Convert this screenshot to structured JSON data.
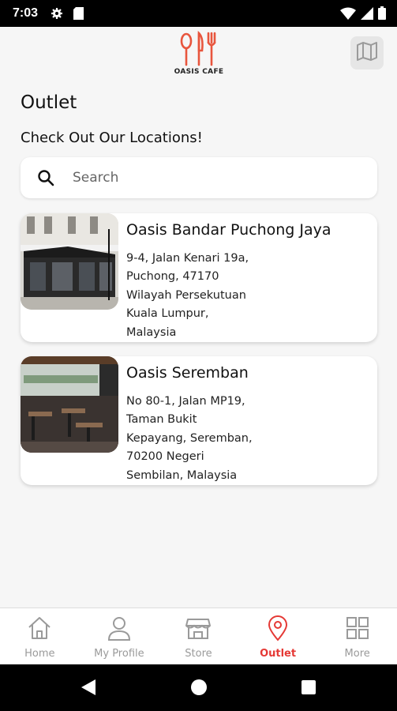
{
  "status_bar": {
    "time": "7:03",
    "left_icons": [
      "gear-icon",
      "sd-card-icon"
    ],
    "right_icons": [
      "wifi-icon",
      "signal-icon",
      "battery-icon"
    ]
  },
  "header": {
    "logo_text": "OASIS CAFE",
    "map_button_icon": "map-icon"
  },
  "page": {
    "title": "Outlet",
    "subtitle": "Check Out Our Locations!"
  },
  "search": {
    "placeholder": "Search",
    "value": ""
  },
  "outlets": [
    {
      "name": "Oasis Bandar Puchong Jaya",
      "address_lines": [
        "9-4, Jalan Kenari 19a,",
        "Puchong, 47170",
        "Wilayah Persekutuan",
        "Kuala Lumpur,",
        "Malaysia"
      ]
    },
    {
      "name": "Oasis Seremban",
      "address_lines": [
        "No 80-1, Jalan MP19,",
        "Taman Bukit",
        "Kepayang, Seremban,",
        "70200 Negeri",
        "Sembilan, Malaysia"
      ]
    }
  ],
  "bottom_nav": {
    "items": [
      {
        "label": "Home",
        "icon": "home-icon"
      },
      {
        "label": "My Profile",
        "icon": "profile-icon"
      },
      {
        "label": "Store",
        "icon": "store-icon"
      },
      {
        "label": "Outlet",
        "icon": "location-pin-icon"
      },
      {
        "label": "More",
        "icon": "grid-icon"
      }
    ],
    "active_index": 3
  },
  "colors": {
    "accent": "#e53935",
    "inactive": "#9a9a9a",
    "logo": "#e8553d"
  }
}
